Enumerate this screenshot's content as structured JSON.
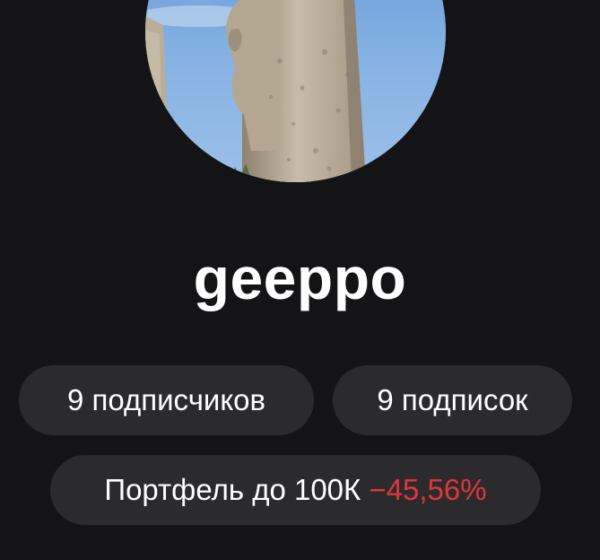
{
  "profile": {
    "username": "geeppo",
    "avatar_icon": "profile-photo-stone-statue"
  },
  "stats": {
    "followers_label": "9 подписчиков",
    "following_label": "9 подписок"
  },
  "portfolio": {
    "name": "Портфель до 100К",
    "change": "−45,56%",
    "change_color": "#e0363b"
  }
}
